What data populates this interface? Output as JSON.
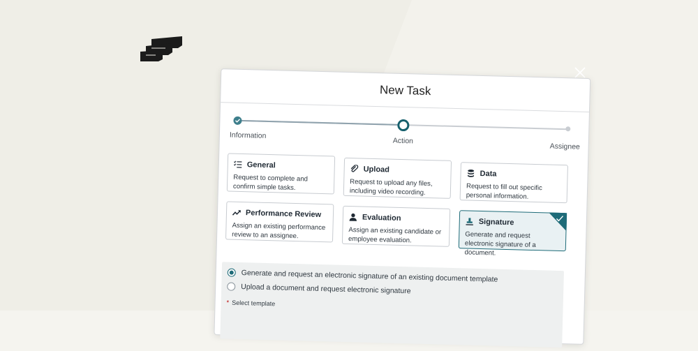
{
  "modal": {
    "title": "New Task"
  },
  "stepper": {
    "steps": [
      {
        "label": "Information",
        "state": "done"
      },
      {
        "label": "Action",
        "state": "current"
      },
      {
        "label": "Assignee",
        "state": "upcoming"
      }
    ]
  },
  "cards": [
    {
      "icon": "checklist-icon",
      "title": "General",
      "description": "Request to complete and confirm simple tasks.",
      "selected": false
    },
    {
      "icon": "paperclip-icon",
      "title": "Upload",
      "description": "Request to upload any files, including video recording.",
      "selected": false
    },
    {
      "icon": "database-icon",
      "title": "Data",
      "description": "Request to fill out specific personal information.",
      "selected": false
    },
    {
      "icon": "trend-up-icon",
      "title": "Performance Review",
      "description": "Assign an existing performance review to an assignee.",
      "selected": false
    },
    {
      "icon": "person-icon",
      "title": "Evaluation",
      "description": "Assign an existing candidate or employee evaluation.",
      "selected": false
    },
    {
      "icon": "signature-stamp-icon",
      "title": "Signature",
      "description": "Generate and request electronic signature of a document.",
      "selected": true
    }
  ],
  "signature_options": {
    "option_1": "Generate and request an electronic signature of an existing document template",
    "option_2": "Upload a document and request electronic signature",
    "selected": "option_1",
    "template_label": "Select template",
    "required_marker": "*"
  },
  "colors": {
    "accent": "#1e6b78",
    "selected_bg": "#e9f1f3",
    "page_bg": "#f3f2ec"
  }
}
